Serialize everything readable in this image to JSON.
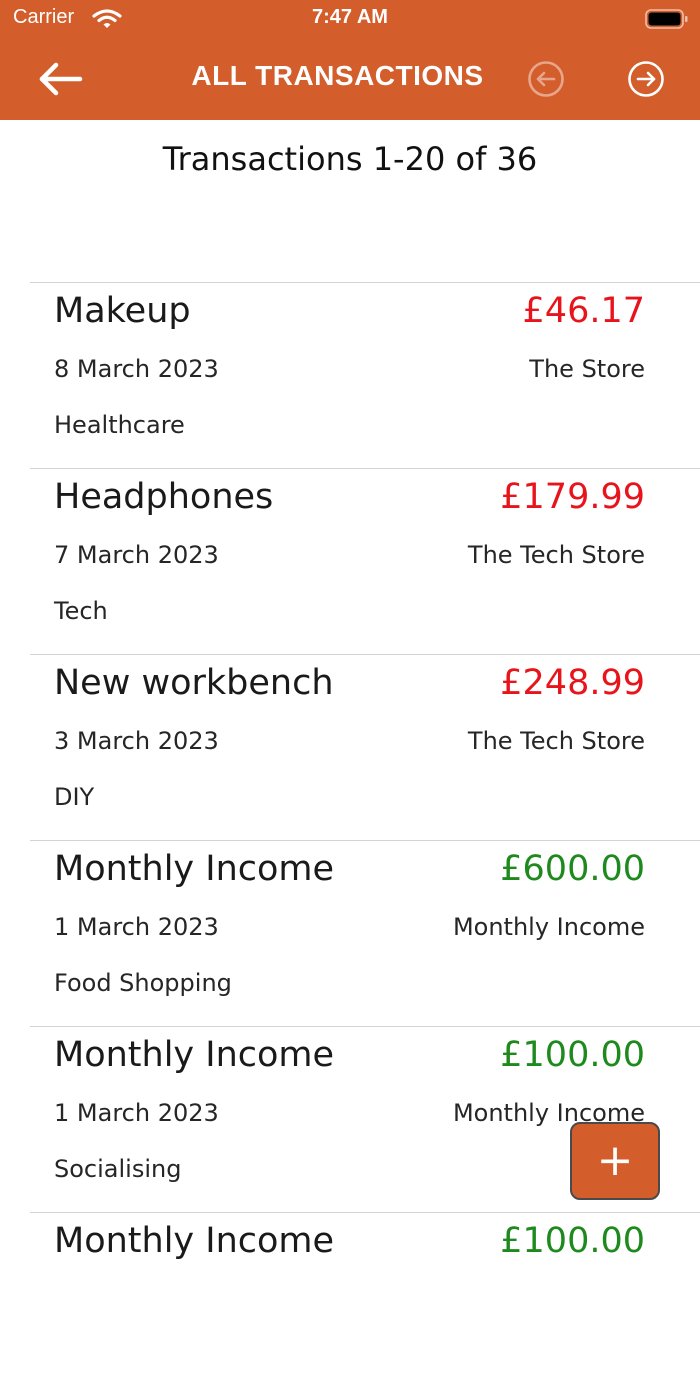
{
  "status_bar": {
    "carrier": "Carrier",
    "time": "7:47 AM"
  },
  "nav": {
    "title": "ALL TRANSACTIONS",
    "back_icon": "arrow-left-icon",
    "prev_icon": "circle-arrow-left-icon",
    "next_icon": "circle-arrow-right-icon"
  },
  "summary": "Transactions 1-20 of 36",
  "colors": {
    "accent": "#D35E2C",
    "expense": "#E8141B",
    "income": "#1E8A1E"
  },
  "transactions": [
    {
      "title": "Makeup",
      "amount": "£46.17",
      "type": "expense",
      "date": "8 March 2023",
      "merchant": "The Store",
      "category": "Healthcare"
    },
    {
      "title": "Headphones",
      "amount": "£179.99",
      "type": "expense",
      "date": "7 March 2023",
      "merchant": "The Tech Store",
      "category": "Tech"
    },
    {
      "title": "New workbench",
      "amount": "£248.99",
      "type": "expense",
      "date": "3 March 2023",
      "merchant": "The Tech Store",
      "category": "DIY"
    },
    {
      "title": "Monthly Income",
      "amount": "£600.00",
      "type": "income",
      "date": "1 March 2023",
      "merchant": "Monthly Income",
      "category": "Food Shopping"
    },
    {
      "title": "Monthly Income",
      "amount": "£100.00",
      "type": "income",
      "date": "1 March 2023",
      "merchant": "Monthly Income",
      "category": "Socialising"
    },
    {
      "title": "Monthly Income",
      "amount": "£100.00",
      "type": "income",
      "date": "",
      "merchant": "",
      "category": ""
    }
  ],
  "add_button": {
    "label": "+"
  }
}
